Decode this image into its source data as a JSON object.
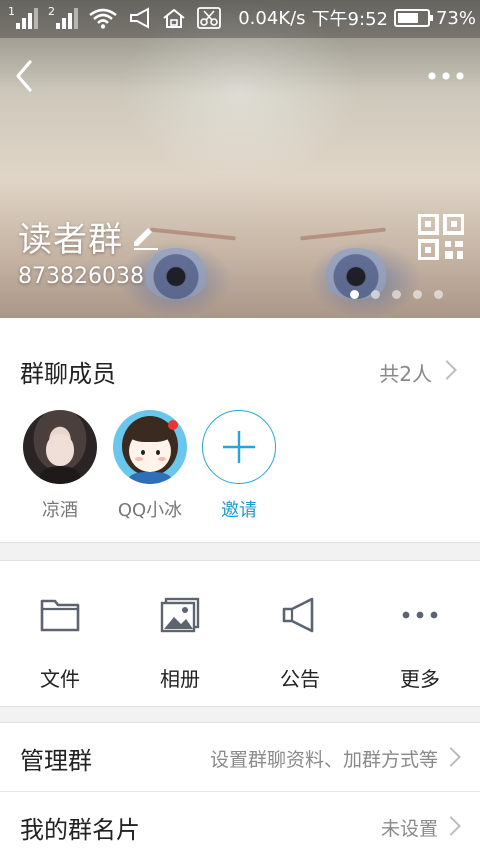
{
  "status": {
    "sim1": "1",
    "sim2": "2",
    "speed": "0.04K/s",
    "time": "下午9:52",
    "battery_percent": "73%",
    "battery_level": 0.73
  },
  "header": {
    "group_name": "读者群",
    "group_number": "873826038",
    "carousel_pages": 5,
    "carousel_active": 0
  },
  "members": {
    "title": "群聊成员",
    "count_label": "共2人",
    "list": [
      {
        "name": "凉酒"
      },
      {
        "name": "QQ小冰"
      }
    ],
    "invite_label": "邀请"
  },
  "actions": [
    {
      "label": "文件",
      "icon": "folder-icon"
    },
    {
      "label": "相册",
      "icon": "album-icon"
    },
    {
      "label": "公告",
      "icon": "megaphone-icon"
    },
    {
      "label": "更多",
      "icon": "more-dots-icon"
    }
  ],
  "settings": [
    {
      "label": "管理群",
      "value": "设置群聊资料、加群方式等"
    },
    {
      "label": "我的群名片",
      "value": "未设置"
    }
  ],
  "colors": {
    "accent": "#1e9bd2",
    "icon_gray": "#5d6470"
  }
}
